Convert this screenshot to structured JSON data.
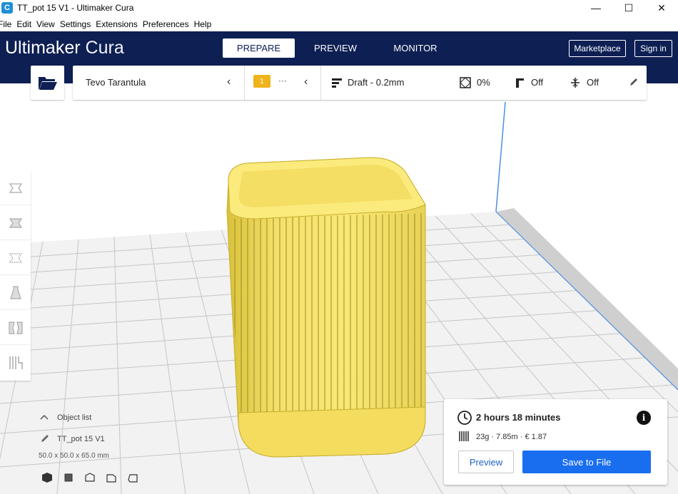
{
  "window": {
    "title": "TT_pot 15 V1  - Ultimaker Cura",
    "app_icon": "C",
    "controls": [
      "—",
      "☐",
      "✕"
    ]
  },
  "menu": [
    "File",
    "Edit",
    "View",
    "Settings",
    "Extensions",
    "Preferences",
    "Help"
  ],
  "header": {
    "brand_bold": "Ultimaker",
    "brand_light": "Cura",
    "tabs": [
      "PREPARE",
      "PREVIEW",
      "MONITOR"
    ],
    "active_tab": "PREPARE",
    "marketplace": "Marketplace",
    "signin": "Sign in"
  },
  "config": {
    "printer": "Tevo Tarantula",
    "extruder_badge": "1",
    "extruder_dots": "···",
    "profile": "Draft - 0.2mm",
    "infill": "0%",
    "support": "Off",
    "adhesion": "Off"
  },
  "objects": {
    "title": "Object list",
    "name": "TT_pot 15 V1",
    "dims": "50.0 x 50.0 x 65.0 mm"
  },
  "print": {
    "time": "2 hours 18 minutes",
    "stats": "23g · 7.85m · € 1.87",
    "preview_label": "Preview",
    "save_label": "Save to File"
  },
  "colors": {
    "header": "#0d1f53",
    "accent": "#196ef0",
    "model": "#f7e26b",
    "badge": "#f0b41b"
  }
}
